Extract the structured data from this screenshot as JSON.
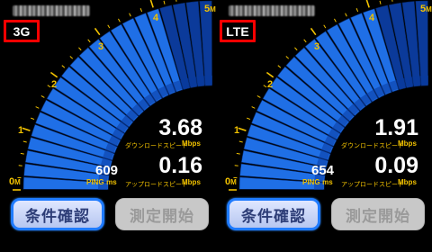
{
  "panels": [
    {
      "network": "3G",
      "download": "3.68",
      "upload": "0.16",
      "ping": "609",
      "gauge_level": 0.82,
      "buttons": {
        "confirm": "条件確認",
        "start": "測定開始"
      }
    },
    {
      "network": "LTE",
      "download": "1.91",
      "upload": "0.09",
      "ping": "654",
      "gauge_level": 0.82,
      "buttons": {
        "confirm": "条件確認",
        "start": "測定開始"
      }
    }
  ],
  "labels": {
    "download_caption": "ダウンロードスピード",
    "upload_caption": "アップロードスピード",
    "unit": "Mbps",
    "ping": "PING",
    "ms": "ms"
  },
  "scale": [
    "0",
    "1",
    "2",
    "3",
    "4",
    "5"
  ],
  "scale_unit": "M",
  "colors": {
    "bar": "#1f6fe6",
    "bar_dark": "#0b3a9a",
    "accent": "#f2c200",
    "badge_border": "#ff0000"
  }
}
